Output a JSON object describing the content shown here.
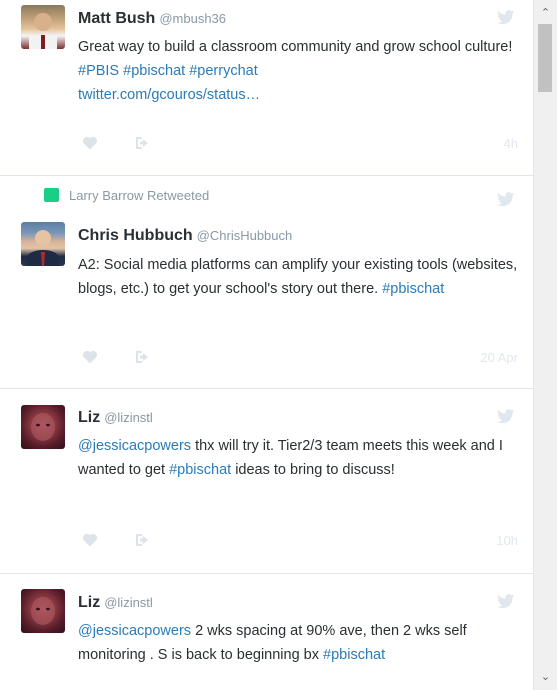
{
  "tweets": [
    {
      "retweet_label": "",
      "name": "Matt Bush",
      "handle": "@mbush36",
      "text_plain": "Great way to build a classroom community and grow school culture! ",
      "hashtags": "#PBIS #pbischat #perrychat",
      "link": "twitter.com/gcouros/status…",
      "time": "4h"
    },
    {
      "retweet_label": "Larry Barrow Retweeted",
      "name": "Chris Hubbuch",
      "handle": "@ChrisHubbuch",
      "text_plain": "A2: Social media platforms can amplify your existing tools (websites, blogs, etc.) to get your school's story out there. ",
      "hashtags": "#pbischat",
      "time": "20 Apr"
    },
    {
      "name": "Liz",
      "handle": "@lizinstl",
      "mention": "@jessicacpowers",
      "text_plain": " thx will try it. Tier2/3 team meets this week and I wanted to get ",
      "hashtags": "#pbischat",
      "text_tail": " ideas to bring to discuss!",
      "time": "10h"
    },
    {
      "name": "Liz",
      "handle": "@lizinstl",
      "mention": "@jessicacpowers",
      "text_plain": " 2 wks spacing at 90% ave, then 2 wks self monitoring .  S is back to beginning bx ",
      "hashtags": "#pbischat"
    }
  ],
  "scrollbar": {
    "up_arrow": "⌃",
    "down_arrow": "⌄"
  },
  "colors": {
    "link": "#2b7bb9",
    "name": "#292f33",
    "muted": "#8899a6",
    "retweet_green": "#19cf86",
    "divider": "#e1e8ed"
  }
}
